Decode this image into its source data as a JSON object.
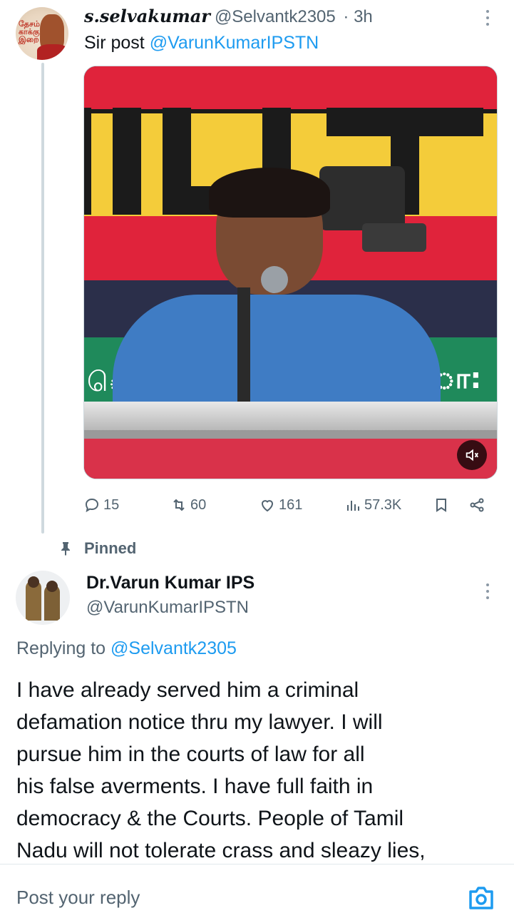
{
  "tweet": {
    "author_name": "s.selvakumar",
    "author_handle": "@Selvantk2305",
    "time": "· 3h",
    "text_prefix": "Sir post",
    "text_mention": "@VarunKumarIPSTN",
    "avatar_text": "தேசம் காக்கும் இறை",
    "media": {
      "overlay_text_left": "ெ",
      "overlay_text_right": "ா:"
    },
    "actions": {
      "replies": "15",
      "reposts": "60",
      "likes": "161",
      "views": "57.3K"
    }
  },
  "pinned_label": "Pinned",
  "reply": {
    "author_name": "Dr.Varun Kumar IPS",
    "author_handle": "@VarunKumarIPSTN",
    "replying_prefix": "Replying to",
    "replying_mention": "@Selvantk2305",
    "lines": [
      "I have already served him a criminal",
      "defamation notice thru my lawyer. I will",
      "pursue him in the courts of law for all",
      "his false averments. I have full faith in",
      "democracy & the Courts. People of Tamil",
      "Nadu will not tolerate crass and sleazy lies,"
    ]
  },
  "composer": {
    "placeholder": "Post your reply"
  },
  "colors": {
    "accent": "#1d9bf0",
    "secondary_text": "#536471"
  },
  "icons": [
    "more-icon",
    "reply-icon",
    "repost-icon",
    "like-icon",
    "views-icon",
    "bookmark-icon",
    "share-icon",
    "pin-icon",
    "mute-icon",
    "camera-icon"
  ]
}
